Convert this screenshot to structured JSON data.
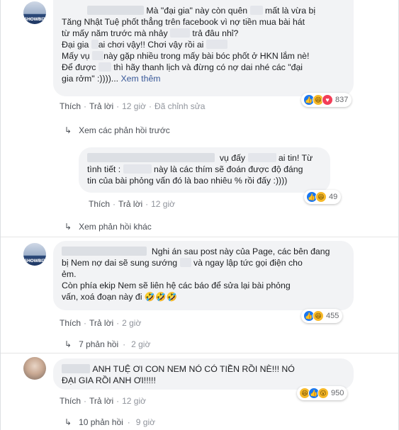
{
  "comments": [
    {
      "avatar_text": "SHOWBIZ",
      "lines": [
        "Mà \"đại gia\" này còn quên ",
        " mất là vừa bị",
        "Tăng Nhật Tuệ phốt thẳng trên facebook vì nợ tiền mua bài hát",
        "từ mấy năm trước mà nhảy ",
        " trả đâu nhỉ?",
        "Đại gia ",
        "ai chơi vậy!! Chơi vậy rồi ai ",
        "Mấy vụ ",
        "này gặp nhiều trong mấy bài bóc phốt ở HKN lắm nè!",
        "Để được ",
        " thì hãy thanh lịch và đừng có nợ dai nhé các \"đại",
        "gia rởm\" :))))... ",
        "Xem thêm"
      ],
      "reaction_count": "837",
      "actions": [
        "Thích",
        "Trả lời",
        "12 giờ",
        "Đã chỉnh sửa"
      ]
    },
    {
      "lines": [
        "vụ đấy ",
        " ai tin! Từ",
        "tình tiết : ",
        " này là các thím sẽ đoán được độ đáng",
        "tin của bài phỏng vấn đó là bao nhiêu % rồi đấy :))))"
      ],
      "reaction_count": "49",
      "actions": [
        "Thích",
        "Trả lời",
        "12 giờ"
      ]
    },
    {
      "avatar_text": "SHOWBIZ",
      "lines": [
        "Nghi án sau post này của Page, các bên đang",
        "bị Nem nợ dai sẽ sung sướng ",
        " và ngay lập tức gọi điện cho",
        "ẻm.",
        "Còn phía ekip Nem sẽ liên hệ các báo để sửa lại bài phỏng",
        "vấn, xoá đoạn này đi 🤣🤣🤣"
      ],
      "reaction_count": "455",
      "actions": [
        "Thích",
        "Trả lời",
        "2 giờ"
      ]
    },
    {
      "lines": [
        "ANH TUỆ ƠI CON NEM NÓ CÓ TIỀN RỒI NÈ!!! NÓ",
        "ĐẠI GIA RỒI ANH ƠI!!!!!"
      ],
      "reaction_count": "950",
      "actions": [
        "Thích",
        "Trả lời",
        "12 giờ"
      ]
    }
  ],
  "threads": {
    "previous_replies": "Xem các phản hồi trước",
    "other_replies": "Xem phản hồi khác",
    "replies_7": "7 phản hồi",
    "replies_7_time": "2 giờ",
    "replies_10": "10 phản hồi",
    "replies_10_time": "9 giờ"
  },
  "colors": {
    "like": "#1877f2",
    "haha": "#f7b928",
    "love": "#f33e58",
    "bubble": "#f2f3f5",
    "link": "#385898"
  }
}
